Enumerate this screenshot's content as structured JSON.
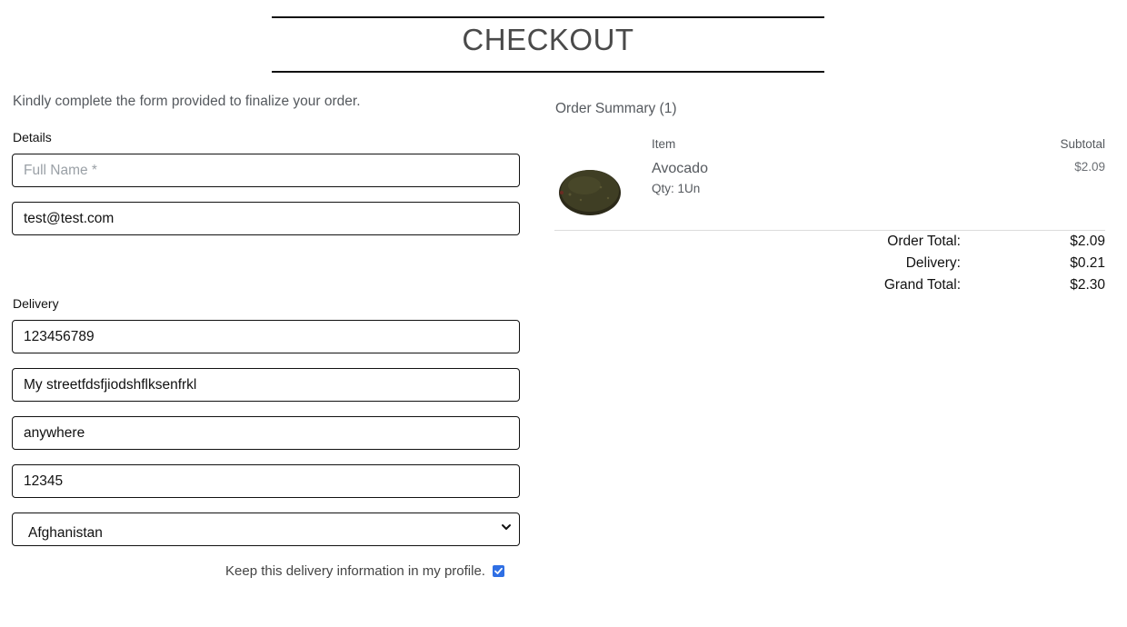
{
  "header": {
    "title": "CHECKOUT"
  },
  "form": {
    "intro": "Kindly complete the form provided to finalize your order.",
    "details_label": "Details",
    "full_name": {
      "value": "",
      "placeholder": "Full Name *"
    },
    "email": {
      "value": "test@test.com"
    },
    "delivery_label": "Delivery",
    "phone": {
      "value": "123456789"
    },
    "street": {
      "value": "My streetfdsfjiodshflksenfrkl"
    },
    "city": {
      "value": "anywhere"
    },
    "postcode": {
      "value": "12345"
    },
    "country": {
      "selected": "Afghanistan",
      "icon": "chevron-down-icon"
    },
    "keep_info_label": "Keep this delivery information in my profile.",
    "keep_info_checked": true
  },
  "summary": {
    "title": "Order Summary (1)",
    "col_item": "Item",
    "col_subtotal": "Subtotal",
    "items": [
      {
        "name": "Avocado",
        "qty": "Qty: 1Un",
        "price": "$2.09",
        "image": "avocado-image"
      }
    ],
    "order_total_label": "Order Total:",
    "order_total_value": "$2.09",
    "delivery_label": "Delivery:",
    "delivery_value": "$0.21",
    "grand_total_label": "Grand Total:",
    "grand_total_value": "$2.30"
  },
  "colors": {
    "checkbox_accent": "#2f6fe4",
    "border": "#111111",
    "muted_text": "#55595e"
  }
}
